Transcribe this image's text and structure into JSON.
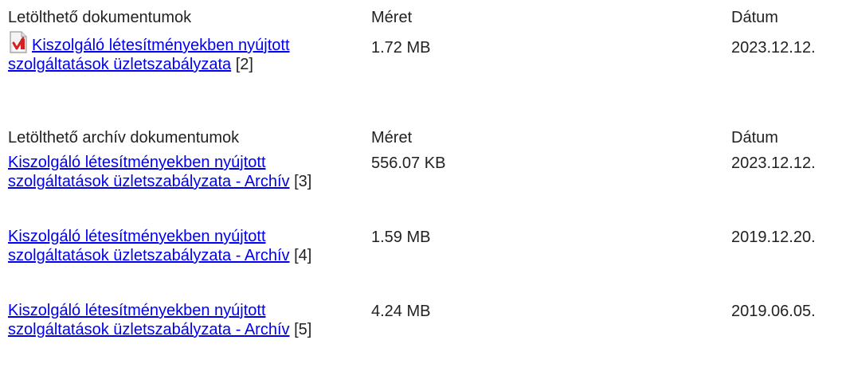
{
  "current": {
    "header": {
      "title": "Letölthető dokumentumok",
      "size": "Méret",
      "date": "Dátum"
    },
    "items": [
      {
        "link_text": "Kiszolgáló létesítményekben nyújtott szolgáltatások üzletszabályzata",
        "ref": "[2]",
        "size": "1.72 MB",
        "date": "2023.12.12.",
        "icon": "pdf-icon"
      }
    ]
  },
  "archive": {
    "header": {
      "title": "Letölthető archív dokumentumok",
      "size": "Méret",
      "date": "Dátum"
    },
    "items": [
      {
        "link_text": "Kiszolgáló létesítményekben nyújtott szolgáltatások üzletszabályzata - Archív",
        "ref": "[3]",
        "size": "556.07 KB",
        "date": "2023.12.12."
      },
      {
        "link_text": "Kiszolgáló létesítményekben nyújtott szolgáltatások üzletszabályzata - Archív",
        "ref": "[4]",
        "size": "1.59 MB",
        "date": "2019.12.20."
      },
      {
        "link_text": "Kiszolgáló létesítményekben nyújtott szolgáltatások üzletszabályzata - Archív",
        "ref": "[5]",
        "size": "4.24 MB",
        "date": "2019.06.05."
      }
    ]
  },
  "colors": {
    "text": "#222222",
    "link": "#0000ee",
    "icon_accent": "#d42020"
  }
}
